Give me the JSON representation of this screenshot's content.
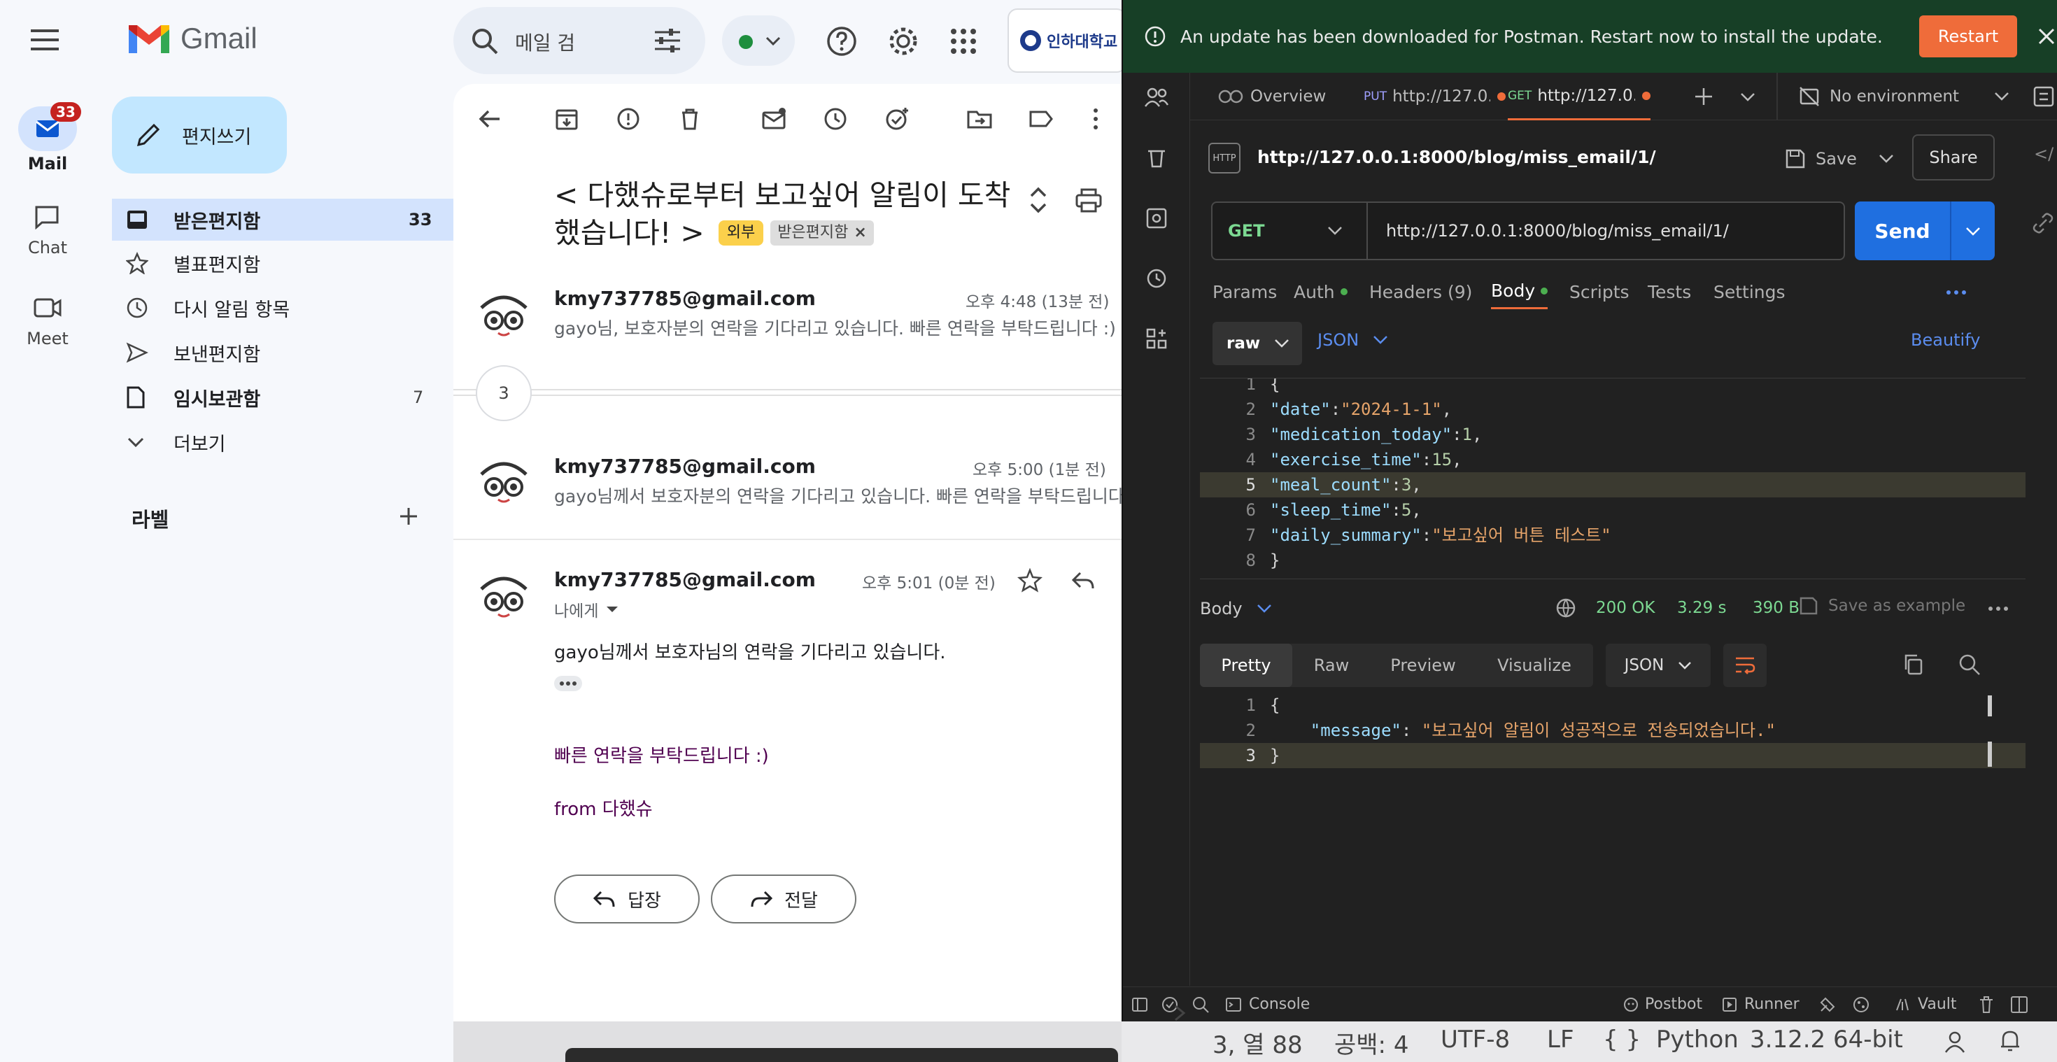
{
  "gmail": {
    "app_name": "Gmail",
    "search_placeholder": "메일 검",
    "org_chip": "인하대학교",
    "rail": {
      "mail_label": "Mail",
      "mail_badge": "33",
      "chat_label": "Chat",
      "meet_label": "Meet"
    },
    "compose_label": "편지쓰기",
    "nav": [
      {
        "label": "받은편지함",
        "count": "33"
      },
      {
        "label": "별표편지함",
        "count": ""
      },
      {
        "label": "다시 알림 항목",
        "count": ""
      },
      {
        "label": "보낸편지함",
        "count": ""
      },
      {
        "label": "임시보관함",
        "count": "7"
      },
      {
        "label": "더보기",
        "count": ""
      }
    ],
    "labels_heading": "라벨",
    "thread": {
      "subject_line1": "< 다했슈로부터 보고싶어 알림이 도착",
      "subject_line2": "했습니다! >",
      "tag_external": "외부",
      "tag_inbox": "받은편지함",
      "collapsed_count": "3",
      "messages": [
        {
          "sender": "kmy737785@gmail.com",
          "date": "오후 4:48 (13분 전)",
          "snippet": "gayo님, 보호자분의 연락을 기다리고 있습니다. 빠른 연락을 부탁드립니다 :)"
        },
        {
          "sender": "kmy737785@gmail.com",
          "date": "오후 5:00 (1분 전)",
          "snippet": "gayo님께서 보호자분의 연락을 기다리고 있습니다. 빠른 연락을 부탁드립니다 :"
        },
        {
          "sender": "kmy737785@gmail.com",
          "date": "오후 5:01 (0분 전)",
          "to": "나에게"
        }
      ],
      "body_line1": "gayo님께서 보호자님의 연락을 기다리고 있습니다.",
      "body_line2": "빠른 연락을 부탁드립니다 :)",
      "body_line3": "from 다했슈",
      "reply_label": "답장",
      "forward_label": "전달"
    }
  },
  "postman": {
    "update_banner": "An update has been downloaded for Postman. Restart now to install the update.",
    "restart_label": "Restart",
    "tabs": {
      "overview": "Overview",
      "tab1_method": "PUT",
      "tab1_url": "http://127.0.0",
      "tab2_method": "GET",
      "tab2_url": "http://127.0.0",
      "environment": "No environment"
    },
    "request_title": "http://127.0.0.1:8000/blog/miss_email/1/",
    "save_label": "Save",
    "share_label": "Share",
    "method": "GET",
    "url": "http://127.0.0.1:8000/blog/miss_email/1/",
    "send_label": "Send",
    "req_tabs": [
      "Params",
      "Auth",
      "Headers (9)",
      "Body",
      "Scripts",
      "Tests",
      "Settings"
    ],
    "body_mode": "raw",
    "body_format": "JSON",
    "beautify_label": "Beautify",
    "request_body": {
      "date": "\"2024-1-1\"",
      "medication_today": "1",
      "exercise_time": "15",
      "meal_count": "3",
      "sleep_time": "5",
      "daily_summary": "\"보고싶어 버튼 테스트\""
    },
    "response": {
      "section_label": "Body",
      "status": "200 OK",
      "time": "3.29 s",
      "size": "390 B",
      "save_example": "Save as example",
      "view_tabs": [
        "Pretty",
        "Raw",
        "Preview",
        "Visualize"
      ],
      "format": "JSON",
      "message_key": "\"message\"",
      "message_value": "\"보고싶어 알림이 성공적으로 전송되었습니다.\""
    },
    "footer": {
      "console": "Console",
      "postbot": "Postbot",
      "runner": "Runner",
      "vault": "Vault"
    }
  },
  "editor_status": {
    "position": "3, 열 88",
    "spaces": "공백: 4",
    "encoding": "UTF-8",
    "eol": "LF",
    "language": "Python",
    "interpreter": "3.12.2 64-bit"
  }
}
